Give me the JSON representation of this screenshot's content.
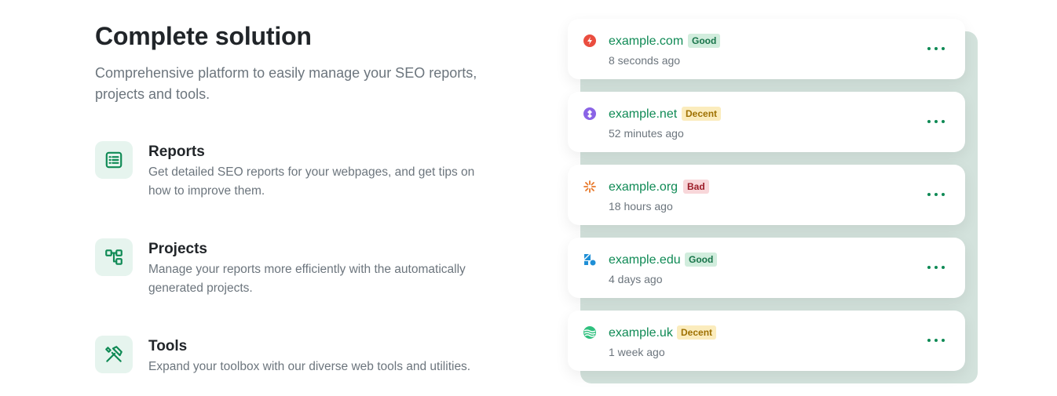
{
  "header": {
    "title": "Complete solution",
    "subtitle": "Comprehensive platform to easily manage your SEO reports, projects and tools."
  },
  "features": [
    {
      "icon": "list-icon",
      "title": "Reports",
      "description": "Get detailed SEO reports for your webpages, and get tips on how to improve them."
    },
    {
      "icon": "project-tree-icon",
      "title": "Projects",
      "description": "Manage your reports more efficiently with the automatically generated projects."
    },
    {
      "icon": "tools-icon",
      "title": "Tools",
      "description": "Expand your toolbox with our diverse web tools and utilities."
    }
  ],
  "reports": [
    {
      "domain": "example.com",
      "status": "Good",
      "status_type": "good",
      "time": "8 seconds ago",
      "favicon": "lightning-icon"
    },
    {
      "domain": "example.net",
      "status": "Decent",
      "status_type": "decent",
      "time": "52 minutes ago",
      "favicon": "purple-gem-icon"
    },
    {
      "domain": "example.org",
      "status": "Bad",
      "status_type": "bad",
      "time": "18 hours ago",
      "favicon": "orange-sun-icon"
    },
    {
      "domain": "example.edu",
      "status": "Good",
      "status_type": "good",
      "time": "4 days ago",
      "favicon": "blue-shapes-icon"
    },
    {
      "domain": "example.uk",
      "status": "Decent",
      "status_type": "decent",
      "time": "1 week ago",
      "favicon": "green-waves-icon"
    }
  ],
  "colors": {
    "accent": "#0f8a55",
    "accent_bg": "#e6f4ee",
    "stack_bg": "#d3e2dc"
  }
}
